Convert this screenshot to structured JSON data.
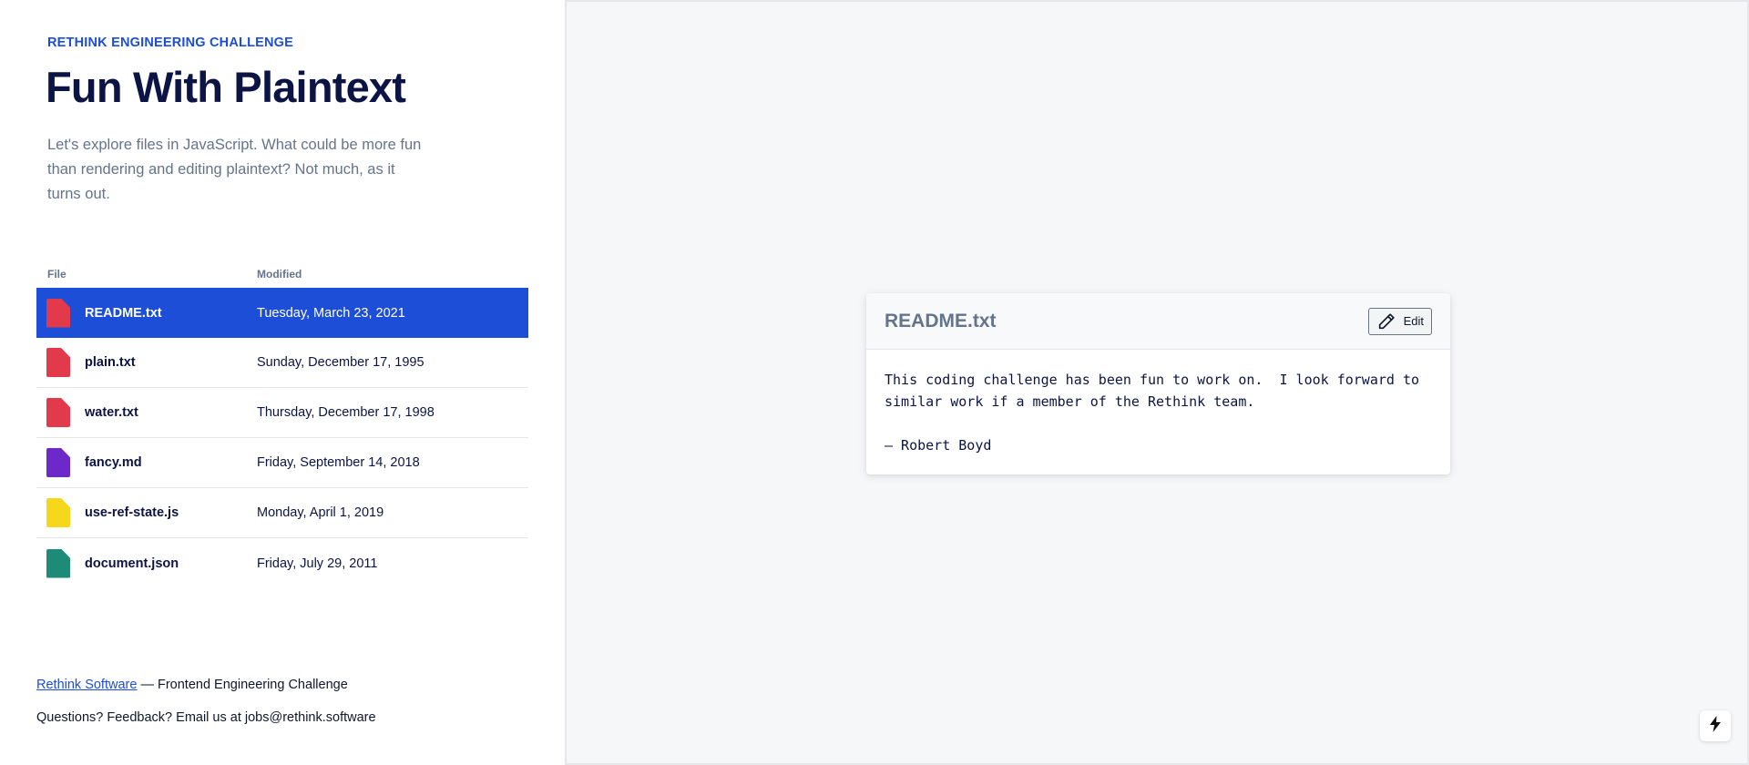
{
  "header": {
    "eyebrow": "RETHINK ENGINEERING CHALLENGE",
    "title": "Fun With Plaintext",
    "intro": "Let's explore files in JavaScript. What could be more fun than rendering and editing plaintext? Not much, as it turns out."
  },
  "table": {
    "col_file": "File",
    "col_modified": "Modified",
    "rows": [
      {
        "name": "README.txt",
        "modified": "Tuesday, March 23, 2021",
        "icon": "txt-file-icon",
        "color": "#e23a4a",
        "selected": true
      },
      {
        "name": "plain.txt",
        "modified": "Sunday, December 17, 1995",
        "icon": "txt-file-icon",
        "color": "#e23a4a",
        "selected": false
      },
      {
        "name": "water.txt",
        "modified": "Thursday, December 17, 1998",
        "icon": "txt-file-icon",
        "color": "#e23a4a",
        "selected": false
      },
      {
        "name": "fancy.md",
        "modified": "Friday, September 14, 2018",
        "icon": "md-file-icon",
        "color": "#6d28c9",
        "selected": false
      },
      {
        "name": "use-ref-state.js",
        "modified": "Monday, April 1, 2019",
        "icon": "js-file-icon",
        "color": "#f5d81c",
        "selected": false
      },
      {
        "name": "document.json",
        "modified": "Friday, July 29, 2011",
        "icon": "json-file-icon",
        "color": "#1e8a78",
        "selected": false
      }
    ]
  },
  "footer": {
    "link_text": "Rethink Software",
    "line1_rest": " — Frontend Engineering Challenge",
    "line2": "Questions? Feedback? Email us at jobs@rethink.software"
  },
  "viewer": {
    "title": "README.txt",
    "edit_label": "Edit",
    "content": "This coding challenge has been fun to work on.  I look forward to\nsimilar work if a member of the Rethink team.\n\n— Robert Boyd"
  },
  "colors": {
    "accent": "#1d4ed8",
    "txt": "#e23a4a",
    "md": "#6d28c9",
    "js": "#f5d81c",
    "json": "#1e8a78"
  }
}
